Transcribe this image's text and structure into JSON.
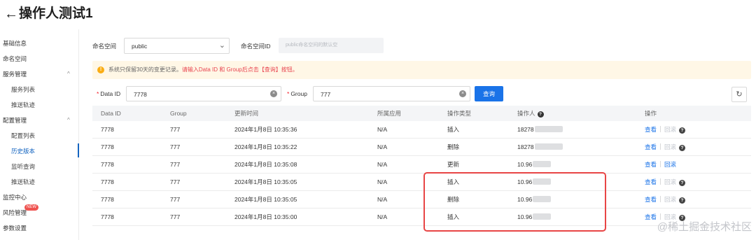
{
  "header": {
    "back_icon": "arrow-left-icon",
    "title": "操作人测试1"
  },
  "sidebar": {
    "items": [
      {
        "label": "基础信息"
      },
      {
        "label": "命名空间"
      },
      {
        "label": "服务管理"
      },
      {
        "label": "服务列表"
      },
      {
        "label": "推送轨迹"
      },
      {
        "label": "配置管理"
      },
      {
        "label": "配置列表"
      },
      {
        "label": "历史版本"
      },
      {
        "label": "监听查询"
      },
      {
        "label": "推送轨迹"
      },
      {
        "label": "监控中心"
      },
      {
        "label": "风险管理"
      },
      {
        "label": "参数设置"
      }
    ],
    "risk_badge": "NEW",
    "active_item": "历史版本",
    "accent_color": "#1565c0"
  },
  "filters": {
    "namespace_label": "命名空间",
    "namespace_value": "public",
    "namespace_id_label": "命名空间ID",
    "namespace_id_value": "public命名空间的默认空",
    "required_mark": "*",
    "dataid_label": "Data ID",
    "dataid_value": "7778",
    "group_label": "Group",
    "group_value": "777",
    "query_label": "查询",
    "refresh_icon": "refresh-icon",
    "clear_icon": "clear-circle-icon"
  },
  "notice": {
    "icon": "warning-circle-icon",
    "text_gray": "系统只保留30天的变更记录。",
    "text_red": "请输入Data ID 和 Group后点击【查询】按钮。",
    "background": "#fff7e6"
  },
  "table": {
    "headers": [
      "Data ID",
      "Group",
      "更新时间",
      "所属应用",
      "操作类型",
      "操作人",
      "操作"
    ],
    "rows": [
      {
        "data_id": "7778",
        "group": "777",
        "time": "2024年1月8日 10:35:36",
        "app": "N/A",
        "type": "插入",
        "operator": "18278",
        "view": "查看",
        "rollback": "回滚",
        "rollback_enabled": false
      },
      {
        "data_id": "7778",
        "group": "777",
        "time": "2024年1月8日 10:35:22",
        "app": "N/A",
        "type": "删除",
        "operator": "18278",
        "view": "查看",
        "rollback": "回滚",
        "rollback_enabled": false
      },
      {
        "data_id": "7778",
        "group": "777",
        "time": "2024年1月8日 10:35:08",
        "app": "N/A",
        "type": "更新",
        "operator": "10.96",
        "view": "查看",
        "rollback": "回滚",
        "rollback_enabled": true
      },
      {
        "data_id": "7778",
        "group": "777",
        "time": "2024年1月8日 10:35:05",
        "app": "N/A",
        "type": "插入",
        "operator": "10.96",
        "view": "查看",
        "rollback": "回滚",
        "rollback_enabled": false
      },
      {
        "data_id": "7778",
        "group": "777",
        "time": "2024年1月8日 10:35:05",
        "app": "N/A",
        "type": "删除",
        "operator": "10.96",
        "view": "查看",
        "rollback": "回滚",
        "rollback_enabled": false
      },
      {
        "data_id": "7778",
        "group": "777",
        "time": "2024年1月8日 10:35:00",
        "app": "N/A",
        "type": "插入",
        "operator": "10.96",
        "view": "查看",
        "rollback": "回滚",
        "rollback_enabled": false
      }
    ]
  },
  "annotation": {
    "color": "#e84545"
  },
  "watermark": "@稀土掘金技术社区"
}
